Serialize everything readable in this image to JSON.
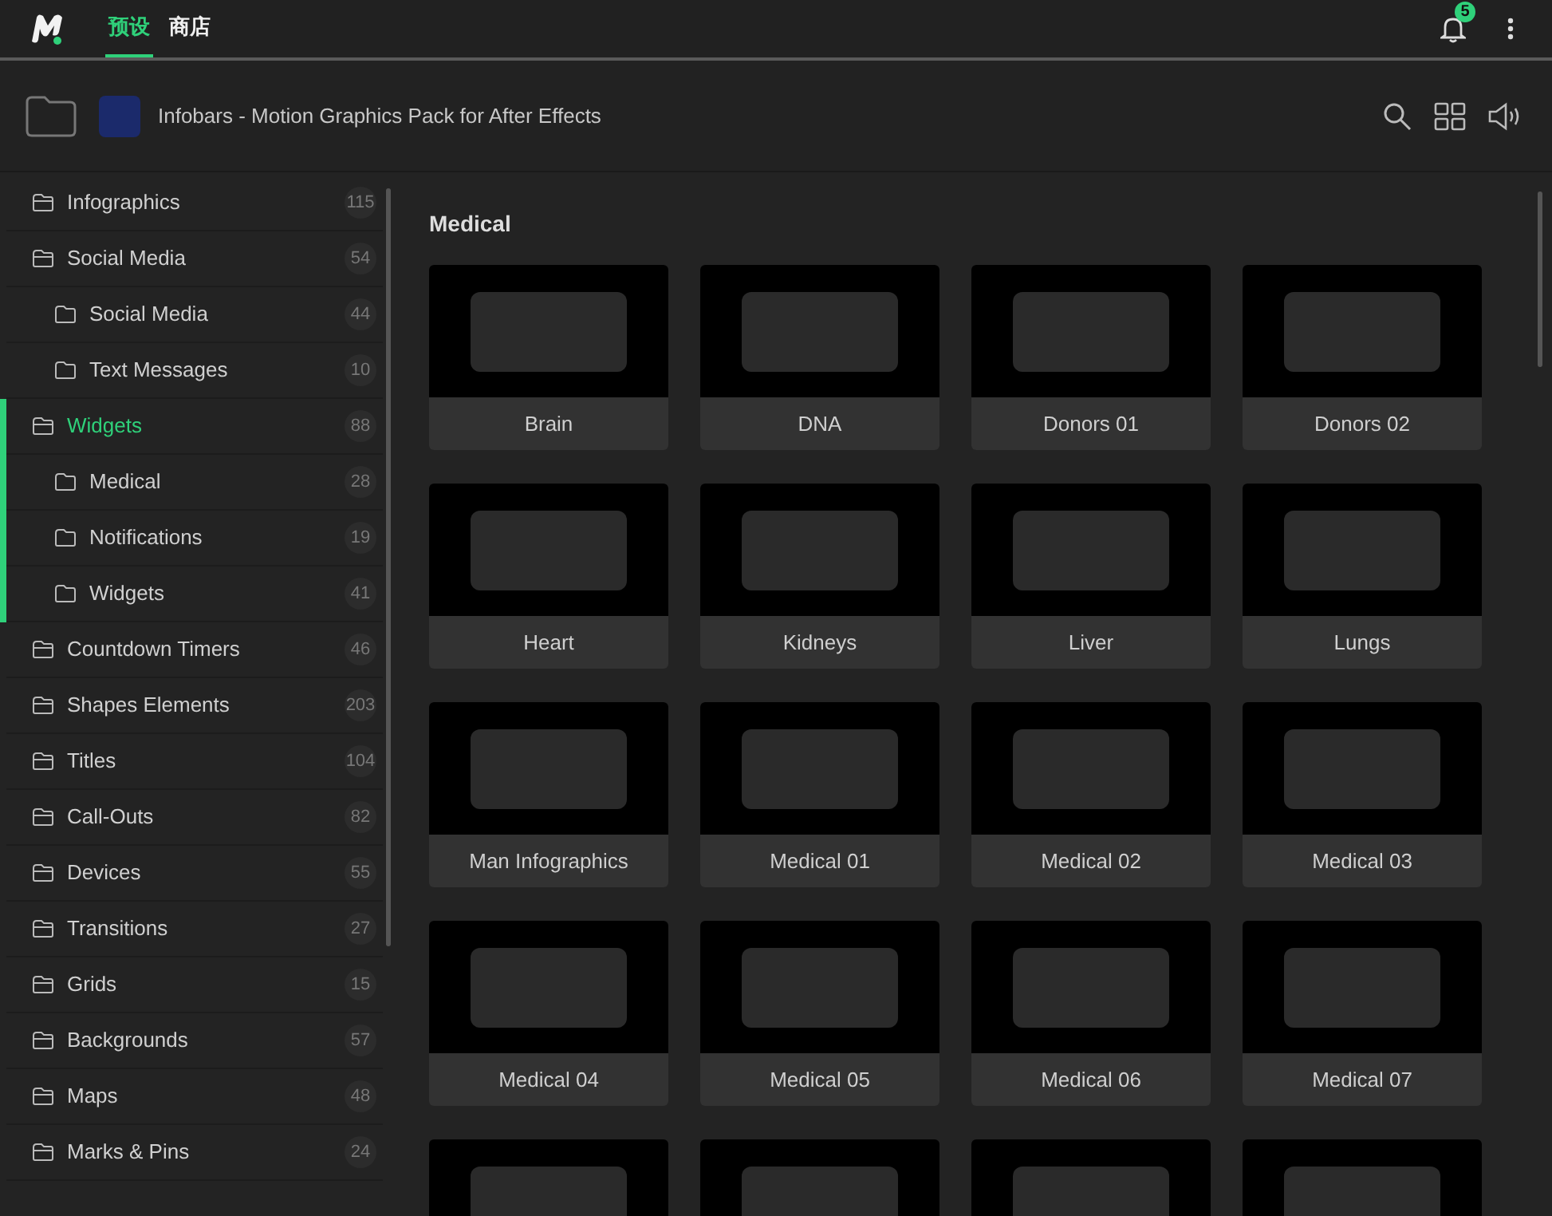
{
  "top_tabs": [
    {
      "label": "预设",
      "selected": true
    },
    {
      "label": "商店",
      "selected": false
    }
  ],
  "notifications": {
    "count": "5"
  },
  "pack": {
    "title": "Infobars - Motion Graphics Pack for After Effects"
  },
  "sidebar": {
    "items": [
      {
        "label": "Infographics",
        "count": "115",
        "selected": false
      },
      {
        "label": "Social Media",
        "count": "54",
        "selected": false,
        "children": [
          {
            "label": "Social Media",
            "count": "44"
          },
          {
            "label": "Text Messages",
            "count": "10"
          }
        ]
      },
      {
        "label": "Widgets",
        "count": "88",
        "selected": true,
        "children": [
          {
            "label": "Medical",
            "count": "28"
          },
          {
            "label": "Notifications",
            "count": "19"
          },
          {
            "label": "Widgets",
            "count": "41"
          }
        ]
      },
      {
        "label": "Countdown Timers",
        "count": "46",
        "selected": false
      },
      {
        "label": "Shapes Elements",
        "count": "203",
        "selected": false
      },
      {
        "label": "Titles",
        "count": "104",
        "selected": false
      },
      {
        "label": "Call-Outs",
        "count": "82",
        "selected": false
      },
      {
        "label": "Devices",
        "count": "55",
        "selected": false
      },
      {
        "label": "Transitions",
        "count": "27",
        "selected": false
      },
      {
        "label": "Grids",
        "count": "15",
        "selected": false
      },
      {
        "label": "Backgrounds",
        "count": "57",
        "selected": false
      },
      {
        "label": "Maps",
        "count": "48",
        "selected": false
      },
      {
        "label": "Marks & Pins",
        "count": "24",
        "selected": false
      }
    ]
  },
  "section": {
    "title": "Medical"
  },
  "presets": [
    {
      "kind": "full",
      "title": "Brain"
    },
    {
      "kind": "full",
      "title": "DNA"
    },
    {
      "kind": "full",
      "title": "Donors 01"
    },
    {
      "kind": "full",
      "title": "Donors 02"
    },
    {
      "kind": "full",
      "title": "Heart"
    },
    {
      "kind": "full",
      "title": "Kidneys"
    },
    {
      "kind": "full",
      "title": "Liver"
    },
    {
      "kind": "full",
      "title": "Lungs"
    },
    {
      "kind": "full",
      "title": "Man Infographics"
    },
    {
      "kind": "full",
      "title": "Medical 01"
    },
    {
      "kind": "full",
      "title": "Medical 02"
    },
    {
      "kind": "full",
      "title": "Medical 03"
    },
    {
      "kind": "full",
      "title": "Medical 04"
    },
    {
      "kind": "full",
      "title": "Medical 05"
    },
    {
      "kind": "full",
      "title": "Medical 06"
    },
    {
      "kind": "full",
      "title": "Medical 07"
    },
    {
      "kind": "cut"
    },
    {
      "kind": "cut"
    },
    {
      "kind": "cut"
    },
    {
      "kind": "cut"
    }
  ]
}
